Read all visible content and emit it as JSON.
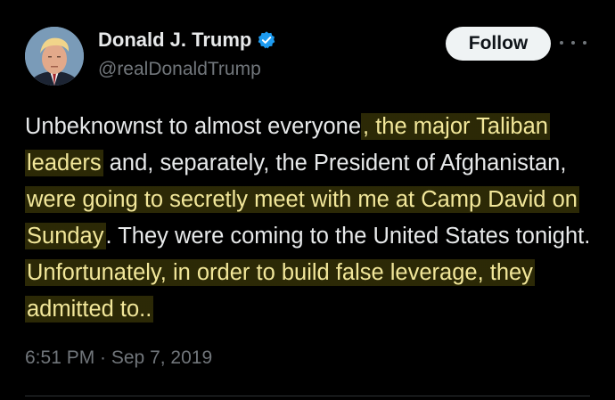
{
  "author": {
    "name": "Donald J. Trump",
    "handle": "@realDonaldTrump",
    "verified_icon": "verified-badge-icon",
    "verified_color": "#1d9bf0"
  },
  "actions": {
    "follow_label": "Follow",
    "more_icon": "more-options-icon"
  },
  "tweet": {
    "segments": [
      "Unbeknownst to almost everyone",
      ", the major Taliban leaders",
      " and, separately, the President of Afghanistan, ",
      "were going to secretly meet with me at Camp David on Sunday",
      ". They were coming to the United States tonight. ",
      "Unfortunately, in order to build false leverage, they admitted to.."
    ],
    "timestamp": "6:51 PM · Sep 7, 2019"
  },
  "colors": {
    "background": "#000000",
    "text": "#e7e9ea",
    "secondary": "#71767b",
    "highlight": "#f2e79a"
  }
}
